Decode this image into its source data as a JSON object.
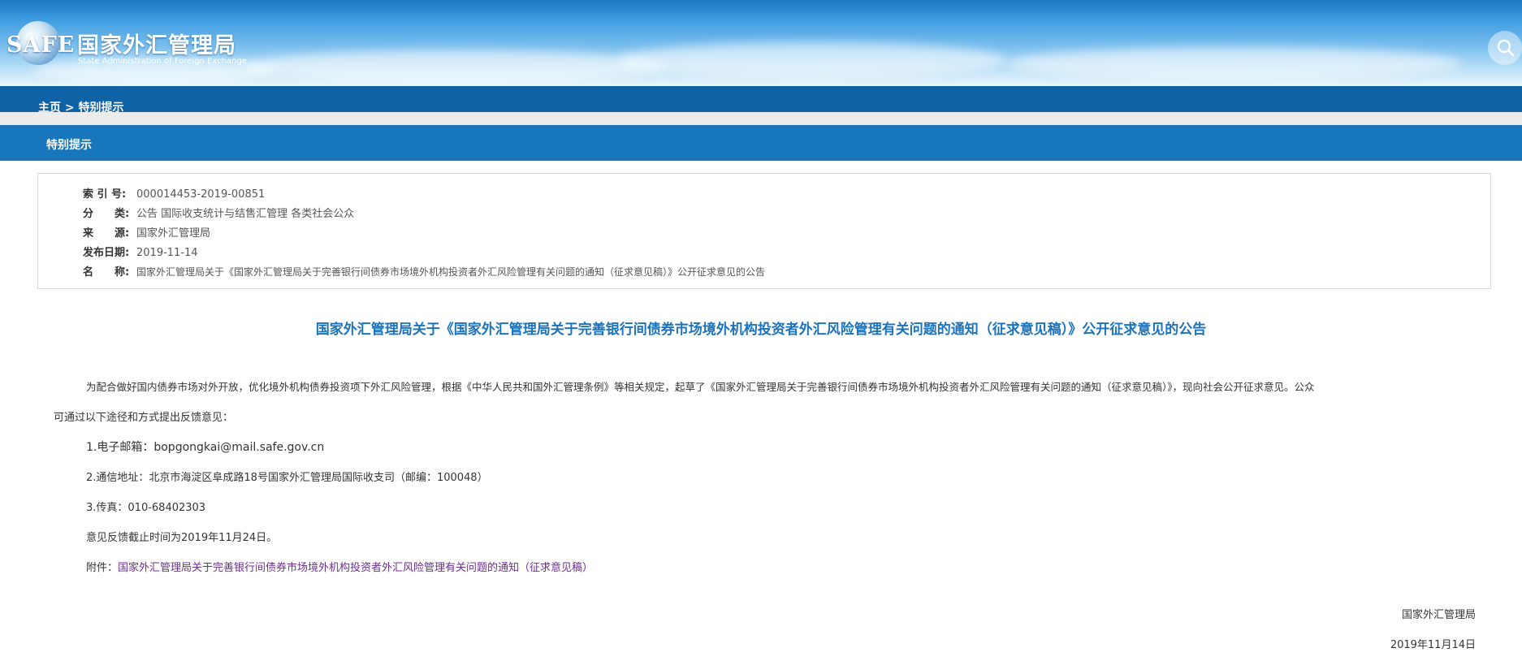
{
  "header": {
    "logo_text": "SAFE",
    "title_cn": "国家外汇管理局",
    "title_en": "State Administration of Foreign Exchange",
    "search_icon": "search-icon"
  },
  "breadcrumb": {
    "home": "主页",
    "separator": " > ",
    "current": "特别提示"
  },
  "section": {
    "title": "特别提示"
  },
  "meta": {
    "index_label": "索 引 号:",
    "index_value": "000014453-2019-00851",
    "category_label": "分　　类:",
    "category_value": "公告  国际收支统计与结售汇管理  各类社会公众",
    "source_label": "来　　源:",
    "source_value": "国家外汇管理局",
    "date_label": "发布日期:",
    "date_value": "2019-11-14",
    "name_label": "名　　称:",
    "name_value": "国家外汇管理局关于《国家外汇管理局关于完善银行间债券市场境外机构投资者外汇风险管理有关问题的通知（征求意见稿）》公开征求意见的公告"
  },
  "doc": {
    "title": "国家外汇管理局关于《国家外汇管理局关于完善银行间债券市场境外机构投资者外汇风险管理有关问题的通知（征求意见稿）》公开征求意见的公告",
    "intro_line1": "为配合做好国内债券市场对外开放，优化境外机构债券投资项下外汇风险管理，根据《中华人民共和国外汇管理条例》等相关规定，起草了《国家外汇管理局关于完善银行间债券市场境外机构投资者外汇风险管理有关问题的通知（征求意见稿）》，现向社会公开征求意见。公众",
    "intro_line2": "可通过以下途径和方式提出反馈意见：",
    "item1": "1.电子邮箱：bopgongkai@mail.safe.gov.cn",
    "item2": "2.通信地址：北京市海淀区阜成路18号国家外汇管理局国际收支司（邮编：100048）",
    "item3": "3.传真：010-68402303",
    "deadline": "意见反馈截止时间为2019年11月24日。",
    "attachment_label": "附件：",
    "attachment_link": "国家外汇管理局关于完善银行间债券市场境外机构投资者外汇风险管理有关问题的通知（征求意见稿）",
    "signature_org": "国家外汇管理局",
    "signature_date": "2019年11月14日"
  }
}
